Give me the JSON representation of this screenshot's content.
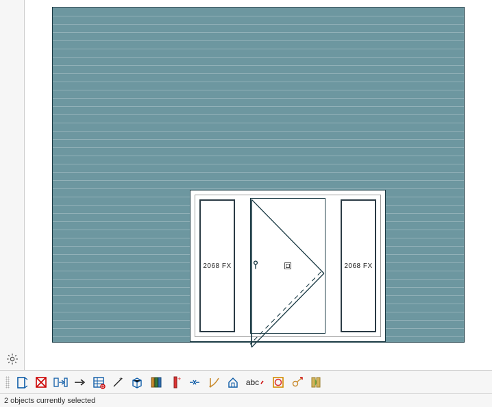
{
  "elevation": {
    "left_sidelight_label": "2068 FX",
    "right_sidelight_label": "2068 FX"
  },
  "toolbar": {
    "items": [
      "door-tool",
      "delete-tool",
      "door-swap-tool",
      "arrow-tool",
      "options-tool",
      "marker-tool",
      "box3d-tool",
      "library-tool",
      "red-marker-tool",
      "break-tool",
      "dimension-tool",
      "house-tool",
      "text-tool",
      "overlay-tool",
      "electrical-tool",
      "columns-tool"
    ],
    "text_label": "abc"
  },
  "status": {
    "message": "2 objects currently selected"
  }
}
